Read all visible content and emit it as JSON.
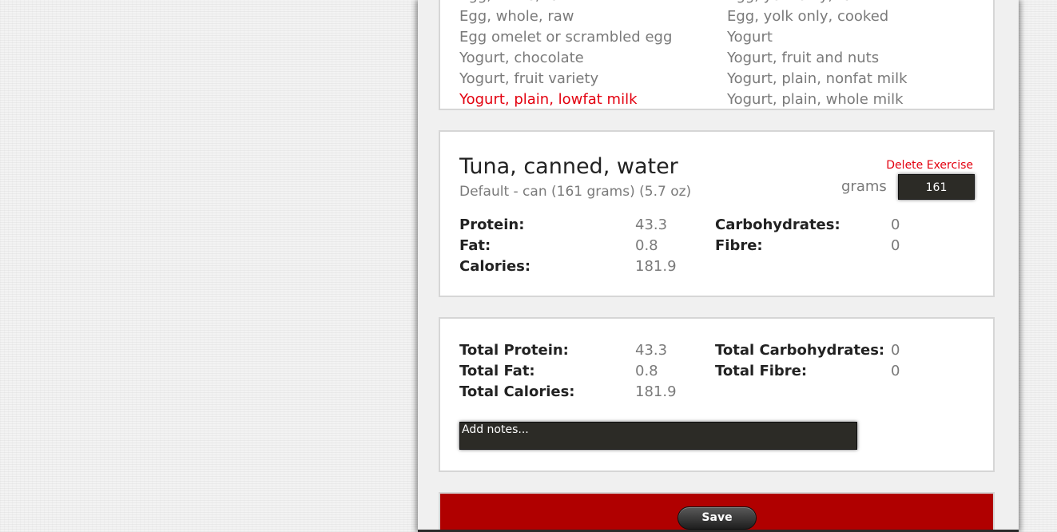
{
  "food_list": {
    "items": [
      {
        "label": "Egg, white, raw",
        "column": 0,
        "row": -1,
        "state": "partial"
      },
      {
        "label": "Egg, yolk only, raw",
        "column": 1,
        "row": -1,
        "state": "partial"
      },
      {
        "label": "Egg, whole, raw",
        "column": 0,
        "row": 0
      },
      {
        "label": "Egg, yolk only, cooked",
        "column": 1,
        "row": 0
      },
      {
        "label": "Egg omelet or scrambled egg",
        "column": 0,
        "row": 1
      },
      {
        "label": "Yogurt",
        "column": 1,
        "row": 1
      },
      {
        "label": "Yogurt, chocolate",
        "column": 0,
        "row": 2
      },
      {
        "label": "Yogurt, fruit and nuts",
        "column": 1,
        "row": 2
      },
      {
        "label": "Yogurt, fruit variety",
        "column": 0,
        "row": 3
      },
      {
        "label": "Yogurt, plain, nonfat milk",
        "column": 1,
        "row": 3
      },
      {
        "label": "Yogurt, plain, lowfat milk",
        "column": 0,
        "row": 4,
        "state": "selected"
      },
      {
        "label": "Yogurt, plain, whole milk",
        "column": 1,
        "row": 4
      }
    ]
  },
  "item": {
    "title": "Tuna, canned, water",
    "serving": "Default - can (161 grams) (5.7 oz)",
    "delete_label": "Delete Exercise",
    "grams_label": "grams",
    "grams_value": "161",
    "nutrients": {
      "protein_label": "Protein:",
      "protein_value": "43.3",
      "fat_label": "Fat:",
      "fat_value": "0.8",
      "calories_label": "Calories:",
      "calories_value": "181.9",
      "carbs_label": "Carbohydrates:",
      "carbs_value": "0",
      "fibre_label": "Fibre:",
      "fibre_value": "0"
    }
  },
  "totals": {
    "protein_label": "Total Protein:",
    "protein_value": "43.3",
    "fat_label": "Total Fat:",
    "fat_value": "0.8",
    "calories_label": "Total Calories:",
    "calories_value": "181.9",
    "carbs_label": "Total Carbohydrates:",
    "carbs_value": "0",
    "fibre_label": "Total Fibre:",
    "fibre_value": "0",
    "notes_placeholder": "Add notes..."
  },
  "actions": {
    "save_label": "Save"
  },
  "colors": {
    "selected_item": "#e3000f",
    "save_bar": "#b00000",
    "input_bg": "#2c2b26"
  }
}
